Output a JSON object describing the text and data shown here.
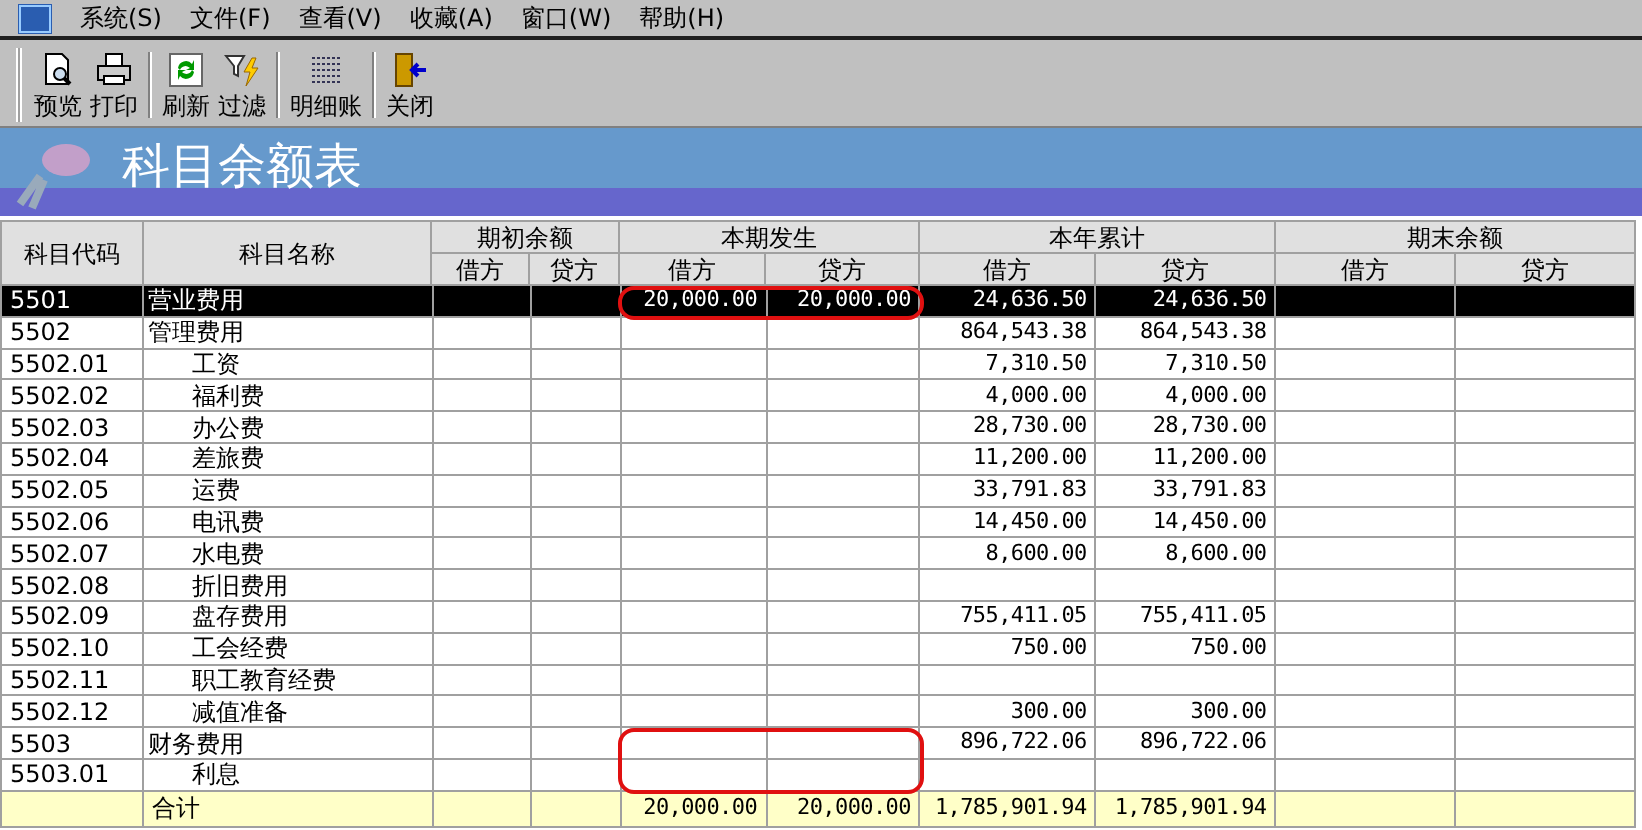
{
  "menu": [
    {
      "label": "系统(S)"
    },
    {
      "label": "文件(F)"
    },
    {
      "label": "查看(V)"
    },
    {
      "label": "收藏(A)"
    },
    {
      "label": "窗口(W)"
    },
    {
      "label": "帮助(H)"
    }
  ],
  "toolbar": [
    {
      "buttons": [
        {
          "kind": "preview",
          "label": "预览"
        },
        {
          "kind": "print",
          "label": "打印"
        }
      ]
    },
    {
      "buttons": [
        {
          "kind": "refresh",
          "label": "刷新"
        },
        {
          "kind": "filter",
          "label": "过滤"
        }
      ]
    },
    {
      "buttons": [
        {
          "kind": "ledger",
          "label": "明细账"
        }
      ]
    },
    {
      "buttons": [
        {
          "kind": "close",
          "label": "关闭"
        }
      ]
    }
  ],
  "banner": {
    "title": "科目余额表"
  },
  "table": {
    "code_header": "科目代码",
    "name_header": "科目名称",
    "groups": [
      {
        "label": "期初余额",
        "columns": [
          "借方",
          "贷方"
        ]
      },
      {
        "label": "本期发生",
        "columns": [
          "借方",
          "贷方"
        ]
      },
      {
        "label": "本年累计",
        "columns": [
          "借方",
          "贷方"
        ]
      },
      {
        "label": "期末余额",
        "columns": [
          "借方",
          "贷方"
        ]
      }
    ],
    "rows": [
      {
        "code": "5501",
        "name": "营业费用",
        "selected": true,
        "circled": true,
        "period": {
          "debit": "20,000.00",
          "credit": "20,000.00"
        },
        "year_to_date": {
          "debit": "24,636.50",
          "credit": "24,636.50"
        }
      },
      {
        "code": "5502",
        "name": "管理费用",
        "selected": false,
        "circled": false,
        "year_to_date": {
          "debit": "864,543.38",
          "credit": "864,543.38"
        },
        "children": [
          {
            "code": "5502.01",
            "name": "工资",
            "selected": false,
            "circled": false,
            "year_to_date": {
              "debit": "7,310.50",
              "credit": "7,310.50"
            }
          },
          {
            "code": "5502.02",
            "name": "福利费",
            "selected": false,
            "circled": false,
            "year_to_date": {
              "debit": "4,000.00",
              "credit": "4,000.00"
            }
          },
          {
            "code": "5502.03",
            "name": "办公费",
            "selected": false,
            "circled": false,
            "year_to_date": {
              "debit": "28,730.00",
              "credit": "28,730.00"
            }
          },
          {
            "code": "5502.04",
            "name": "差旅费",
            "selected": false,
            "circled": false,
            "year_to_date": {
              "debit": "11,200.00",
              "credit": "11,200.00"
            }
          },
          {
            "code": "5502.05",
            "name": "运费",
            "selected": false,
            "circled": false,
            "year_to_date": {
              "debit": "33,791.83",
              "credit": "33,791.83"
            }
          },
          {
            "code": "5502.06",
            "name": "电讯费",
            "selected": false,
            "circled": false,
            "year_to_date": {
              "debit": "14,450.00",
              "credit": "14,450.00"
            }
          },
          {
            "code": "5502.07",
            "name": "水电费",
            "selected": false,
            "circled": false,
            "year_to_date": {
              "debit": "8,600.00",
              "credit": "8,600.00"
            }
          },
          {
            "code": "5502.08",
            "name": "折旧费用",
            "selected": false,
            "circled": false
          },
          {
            "code": "5502.09",
            "name": "盘存费用",
            "selected": false,
            "circled": false,
            "year_to_date": {
              "debit": "755,411.05",
              "credit": "755,411.05"
            }
          },
          {
            "code": "5502.10",
            "name": "工会经费",
            "selected": false,
            "circled": false,
            "year_to_date": {
              "debit": "750.00",
              "credit": "750.00"
            }
          },
          {
            "code": "5502.11",
            "name": "职工教育经费",
            "selected": false,
            "circled": false
          },
          {
            "code": "5502.12",
            "name": "减值准备",
            "selected": false,
            "circled": false,
            "year_to_date": {
              "debit": "300.00",
              "credit": "300.00"
            }
          }
        ]
      },
      {
        "code": "5503",
        "name": "财务费用",
        "selected": false,
        "circled": true,
        "year_to_date": {
          "debit": "896,722.06",
          "credit": "896,722.06"
        },
        "children": [
          {
            "code": "5503.01",
            "name": "利息",
            "selected": false,
            "circled": true
          }
        ]
      }
    ],
    "total": {
      "name": "合计",
      "period": {
        "debit": "20,000.00",
        "credit": "20,000.00"
      },
      "year_to_date": {
        "debit": "1,785,901.94",
        "credit": "1,785,901.94"
      }
    }
  }
}
